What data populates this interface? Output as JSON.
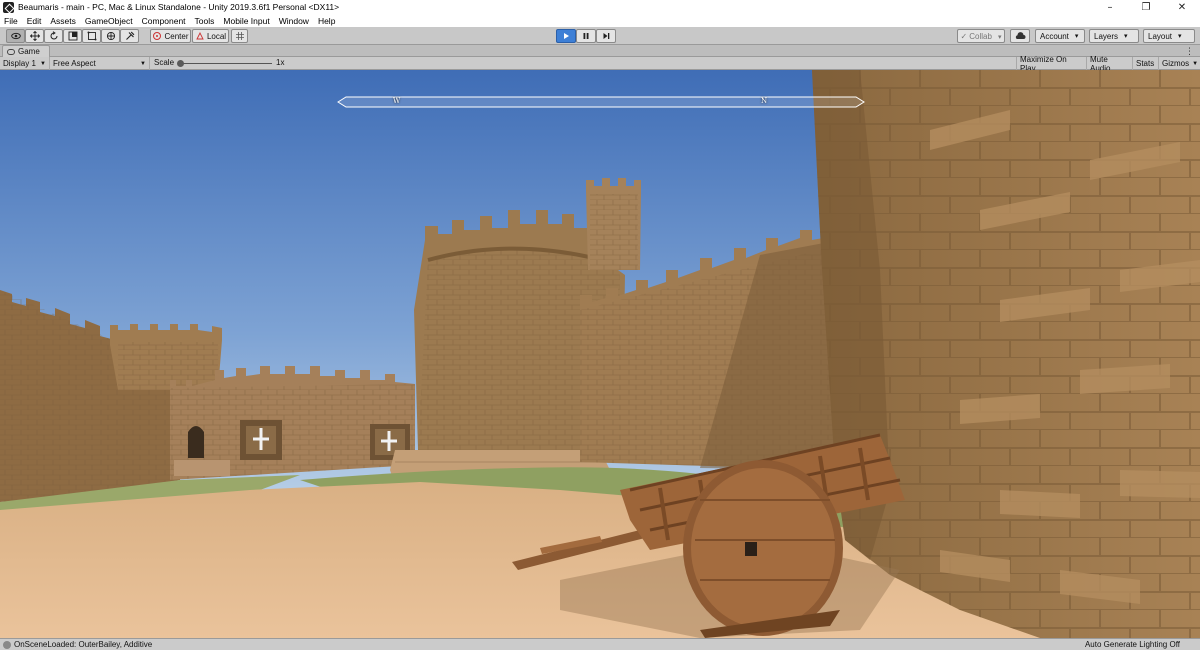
{
  "window": {
    "title": "Beaumaris - main - PC, Mac & Linux Standalone - Unity 2019.3.6f1 Personal <DX11>",
    "controls": {
      "minimize": "–",
      "restore": "❐",
      "close": "✕"
    }
  },
  "menu": [
    "File",
    "Edit",
    "Assets",
    "GameObject",
    "Component",
    "Tools",
    "Mobile Input",
    "Window",
    "Help"
  ],
  "toolbar": {
    "tools": [
      "hand-tool",
      "move-tool",
      "rotate-tool",
      "scale-tool",
      "rect-tool",
      "transform-tool",
      "custom-tool"
    ],
    "pivot_label": "Center",
    "space_label": "Local",
    "collab_label": "Collab",
    "account_label": "Account",
    "layers_label": "Layers",
    "layout_label": "Layout",
    "play_active": true
  },
  "game_tab": {
    "label": "Game"
  },
  "game_controls": {
    "display": "Display 1",
    "aspect": "Free Aspect",
    "scale_label": "Scale",
    "scale_value": "1x",
    "maximize_on_play": "Maximize On Play",
    "mute_audio": "Mute Audio",
    "stats": "Stats",
    "gizmos": "Gizmos"
  },
  "viewport": {
    "compass": {
      "west": "W",
      "north": "N"
    },
    "colors": {
      "sky_top": "#4c78bd",
      "sky_bottom": "#b7cfe6",
      "stone": "#9c7a52",
      "sand": "#e0b88c",
      "grass": "#8fa061"
    }
  },
  "status": {
    "message": "OnSceneLoaded: OuterBailey, Additive",
    "lighting": "Auto Generate Lighting Off"
  }
}
